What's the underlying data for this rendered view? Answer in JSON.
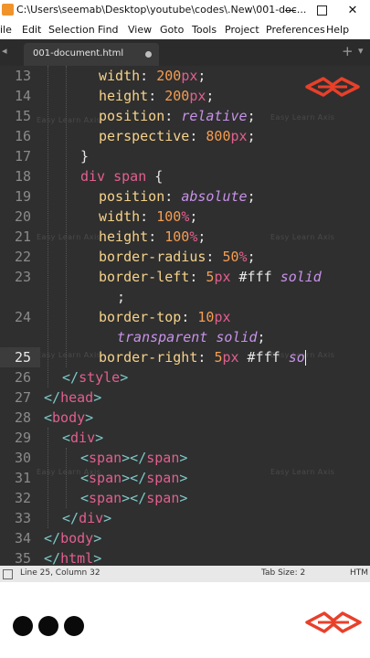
{
  "window": {
    "title": "C:\\Users\\seemab\\Desktop\\youtube\\codes\\.New\\001-doc...",
    "minimize_glyph": "—",
    "close_glyph": "✕"
  },
  "menu": [
    "ile",
    "Edit",
    "Selection",
    "Find",
    "View",
    "Goto",
    "Tools",
    "Project",
    "Preferences",
    "Help"
  ],
  "tabs": {
    "active_label": "001-document.html",
    "plus": "+",
    "chevron": "▾",
    "left_arrow": "◂"
  },
  "editor": {
    "current_line": "25",
    "line_numbers": [
      "13",
      "14",
      "15",
      "16",
      "17",
      "18",
      "19",
      "20",
      "21",
      "22",
      "23",
      "",
      "24",
      "",
      "25",
      "26",
      "27",
      "28",
      "29",
      "30",
      "31",
      "32",
      "33",
      "34",
      "35"
    ],
    "lines": [
      {
        "t": [
          [
            "prop",
            "width"
          ],
          [
            "punc",
            ": "
          ],
          [
            "num",
            "200"
          ],
          [
            "unit",
            "px"
          ],
          [
            "punc",
            ";"
          ]
        ]
      },
      {
        "t": [
          [
            "prop",
            "height"
          ],
          [
            "punc",
            ": "
          ],
          [
            "num",
            "200"
          ],
          [
            "unit",
            "px"
          ],
          [
            "punc",
            ";"
          ]
        ]
      },
      {
        "t": [
          [
            "prop",
            "position"
          ],
          [
            "punc",
            ": "
          ],
          [
            "val",
            "relative"
          ],
          [
            "punc",
            ";"
          ]
        ]
      },
      {
        "t": [
          [
            "prop",
            "perspective"
          ],
          [
            "punc",
            ": "
          ],
          [
            "num",
            "800"
          ],
          [
            "unit",
            "px"
          ],
          [
            "punc",
            ";"
          ]
        ]
      },
      {
        "t": [
          [
            "punc",
            "}"
          ]
        ]
      },
      {
        "t": [
          [
            "kw",
            "div span"
          ],
          [
            "punc",
            " {"
          ]
        ]
      },
      {
        "t": [
          [
            "prop",
            "position"
          ],
          [
            "punc",
            ": "
          ],
          [
            "val",
            "absolute"
          ],
          [
            "punc",
            ";"
          ]
        ]
      },
      {
        "t": [
          [
            "prop",
            "width"
          ],
          [
            "punc",
            ": "
          ],
          [
            "num",
            "100"
          ],
          [
            "unit",
            "%"
          ],
          [
            "punc",
            ";"
          ]
        ]
      },
      {
        "t": [
          [
            "prop",
            "height"
          ],
          [
            "punc",
            ": "
          ],
          [
            "num",
            "100"
          ],
          [
            "unit",
            "%"
          ],
          [
            "punc",
            ";"
          ]
        ]
      },
      {
        "t": [
          [
            "prop",
            "border-radius"
          ],
          [
            "punc",
            ": "
          ],
          [
            "num",
            "50"
          ],
          [
            "unit",
            "%"
          ],
          [
            "punc",
            ";"
          ]
        ]
      },
      {
        "t": [
          [
            "prop",
            "border-left"
          ],
          [
            "punc",
            ": "
          ],
          [
            "num",
            "5"
          ],
          [
            "unit",
            "px"
          ],
          [
            "hex",
            " #fff "
          ],
          [
            "val",
            "solid"
          ]
        ]
      },
      {
        "t": [
          [
            "punc",
            ";"
          ]
        ]
      },
      {
        "t": [
          [
            "prop",
            "border-top"
          ],
          [
            "punc",
            ": "
          ],
          [
            "num",
            "10"
          ],
          [
            "unit",
            "px"
          ]
        ]
      },
      {
        "t": [
          [
            "val",
            "transparent solid"
          ],
          [
            "punc",
            ";"
          ]
        ]
      },
      {
        "t": [
          [
            "prop",
            "border-right"
          ],
          [
            "punc",
            ": "
          ],
          [
            "num",
            "5"
          ],
          [
            "unit",
            "px"
          ],
          [
            "hex",
            " #fff "
          ],
          [
            "val",
            "so"
          ]
        ]
      },
      {
        "t": [
          [
            "br",
            "</"
          ],
          [
            "tag",
            "style"
          ],
          [
            "br",
            ">"
          ]
        ]
      },
      {
        "t": [
          [
            "br",
            "</"
          ],
          [
            "tag",
            "head"
          ],
          [
            "br",
            ">"
          ]
        ]
      },
      {
        "t": [
          [
            "br",
            "<"
          ],
          [
            "tag",
            "body"
          ],
          [
            "br",
            ">"
          ]
        ]
      },
      {
        "t": [
          [
            "br",
            "<"
          ],
          [
            "tag",
            "div"
          ],
          [
            "br",
            ">"
          ]
        ]
      },
      {
        "t": [
          [
            "br",
            "<"
          ],
          [
            "tag",
            "span"
          ],
          [
            "br",
            "></"
          ],
          [
            "tag",
            "span"
          ],
          [
            "br",
            ">"
          ]
        ]
      },
      {
        "t": [
          [
            "br",
            "<"
          ],
          [
            "tag",
            "span"
          ],
          [
            "br",
            "></"
          ],
          [
            "tag",
            "span"
          ],
          [
            "br",
            ">"
          ]
        ]
      },
      {
        "t": [
          [
            "br",
            "<"
          ],
          [
            "tag",
            "span"
          ],
          [
            "br",
            "></"
          ],
          [
            "tag",
            "span"
          ],
          [
            "br",
            ">"
          ]
        ]
      },
      {
        "t": [
          [
            "br",
            "</"
          ],
          [
            "tag",
            "div"
          ],
          [
            "br",
            ">"
          ]
        ]
      },
      {
        "t": [
          [
            "br",
            "</"
          ],
          [
            "tag",
            "body"
          ],
          [
            "br",
            ">"
          ]
        ]
      },
      {
        "t": [
          [
            "br",
            "</"
          ],
          [
            "tag",
            "html"
          ],
          [
            "br",
            ">"
          ]
        ]
      }
    ],
    "watermark": "Easy Learn Axis"
  },
  "status": {
    "position": "Line 25, Column 32",
    "tab_size": "Tab Size: 2",
    "syntax": "HTM"
  },
  "colors": {
    "editor_bg": "#2f2f2f",
    "accent_logo": "#e8402a",
    "property": "#f6d28a",
    "number": "#f59d52",
    "keyword": "#e25f8f",
    "value": "#c792ea"
  }
}
